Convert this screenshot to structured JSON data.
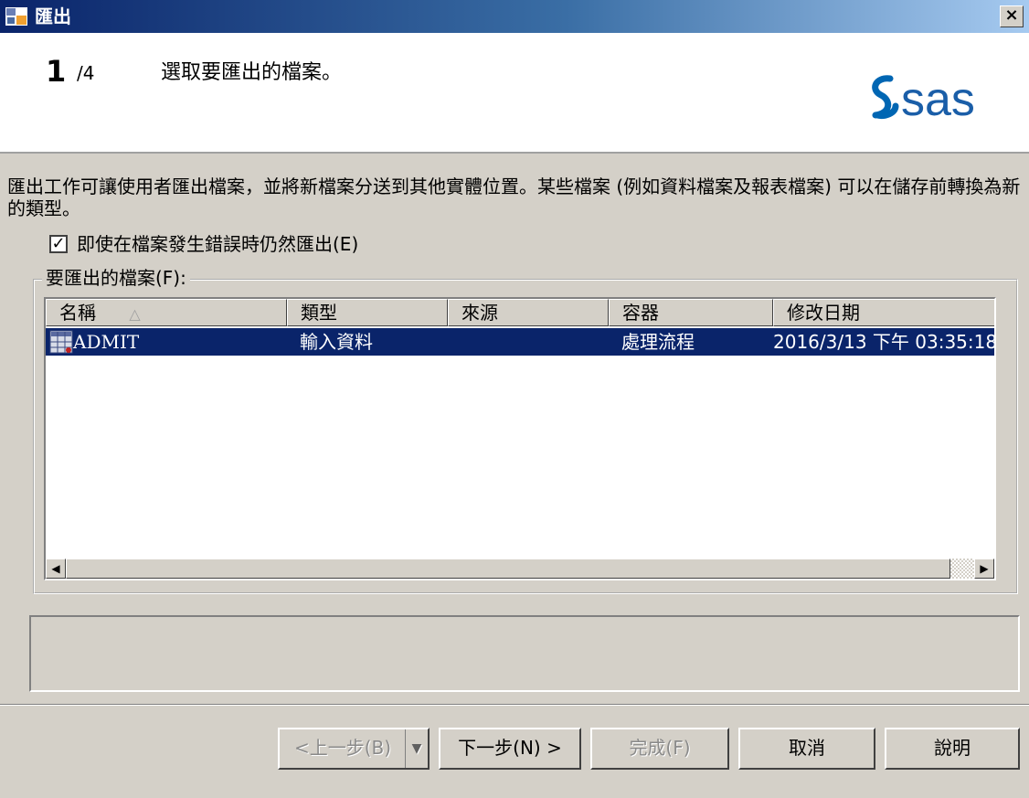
{
  "window": {
    "title": "匯出",
    "close_glyph": "×"
  },
  "header": {
    "step_number": "1",
    "step_total": "/4",
    "step_title": "選取要匯出的檔案。",
    "logo_text": "sas"
  },
  "description": "匯出工作可讓使用者匯出檔案，並將新檔案分送到其他實體位置。某些檔案 (例如資料檔案及報表檔案) 可以在儲存前轉換為新的類型。",
  "checkbox": {
    "label": "即使在檔案發生錯誤時仍然匯出(E)",
    "checked": true,
    "check_glyph": "✓"
  },
  "files_group": {
    "label": "要匯出的檔案(F):",
    "columns": [
      "名稱",
      "類型",
      "來源",
      "容器",
      "修改日期"
    ],
    "sort_glyph": "△",
    "rows": [
      {
        "name": "ADMIT",
        "type": "輸入資料",
        "source": "",
        "container": "處理流程",
        "modified": "2016/3/13 下午 03:35:18"
      }
    ],
    "scroll_left_glyph": "◀",
    "scroll_right_glyph": "▶"
  },
  "buttons": {
    "back": "<上一步(B)",
    "back_dropdown_glyph": "▼",
    "next": "下一步(N) >",
    "finish": "完成(F)",
    "cancel": "取消",
    "help": "說明"
  },
  "colors": {
    "selection": "#0a246a",
    "sas_blue": "#0066b3",
    "dialog_face": "#d4d0c8"
  }
}
